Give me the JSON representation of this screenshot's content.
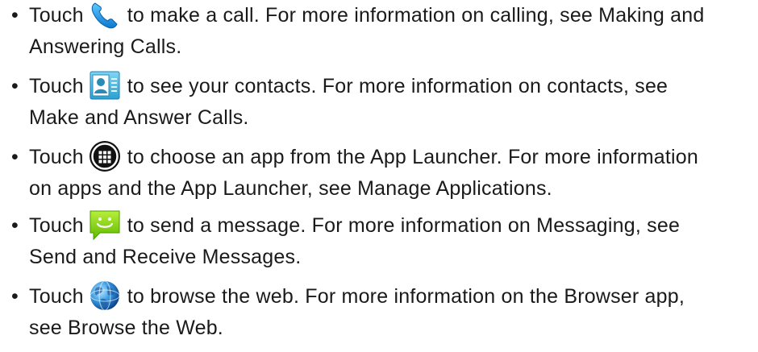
{
  "items": [
    {
      "bullet": "•",
      "pre": "Touch",
      "icon": "phone-icon",
      "post": "to make a call. For more information on calling, see Making and",
      "line2": "Answering Calls."
    },
    {
      "bullet": "•",
      "pre": "Touch",
      "icon": "contacts-icon",
      "post": "to see your contacts. For more information on contacts, see",
      "line2": "Make and Answer Calls."
    },
    {
      "bullet": "•",
      "pre": "Touch",
      "icon": "app-launcher-icon",
      "post": "to choose an app from the App Launcher. For more information",
      "line2": "on apps and the App Launcher, see Manage Applications."
    },
    {
      "bullet": "•",
      "pre": "Touch",
      "icon": "messaging-icon",
      "post": "to send a message. For more information on Messaging, see",
      "line2": "Send and Receive Messages."
    },
    {
      "bullet": "•",
      "pre": "Touch",
      "icon": "browser-globe-icon",
      "post": "to browse the web. For more information on the Browser app,",
      "line2": "see Browse the Web."
    }
  ]
}
